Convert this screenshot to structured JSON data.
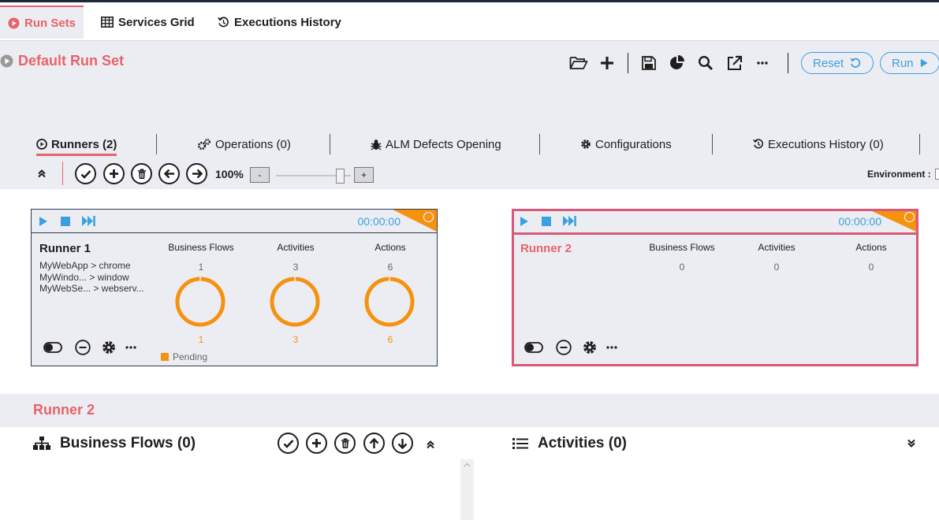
{
  "tabs": [
    {
      "label": "Run Sets",
      "icon": "play-circle-icon",
      "active": true
    },
    {
      "label": "Services Grid",
      "icon": "table-icon",
      "active": false
    },
    {
      "label": "Executions History",
      "icon": "history-icon",
      "active": false
    }
  ],
  "runset": {
    "title": "Default Run Set",
    "toolbar": [
      "folder-open-icon",
      "plus-icon",
      "save-icon",
      "pie-chart-icon",
      "search-icon",
      "external-link-icon",
      "more-icon"
    ],
    "reset_label": "Reset",
    "run_label": "Run"
  },
  "subtabs": [
    {
      "label": "Runners (2)",
      "icon": "play-circle-icon",
      "active": true
    },
    {
      "label": "Operations (0)",
      "icon": "gears-icon",
      "active": false
    },
    {
      "label": "ALM Defects Opening",
      "icon": "bug-icon",
      "active": false
    },
    {
      "label": "Configurations",
      "icon": "gear-icon",
      "active": false
    },
    {
      "label": "Executions History (0)",
      "icon": "history-icon",
      "active": false
    }
  ],
  "runner_toolbar": {
    "zoom": "100%",
    "zoom_minus": "-",
    "zoom_plus": "+",
    "zoom_level": 0.9,
    "environment_label": "Environment :"
  },
  "runners": [
    {
      "name": "Runner 1",
      "timer": "00:00:00",
      "apps": [
        "MyWebApp > chrome",
        "MyWindo... > window",
        "MyWebSe... > webserv..."
      ],
      "columns": [
        {
          "label": "Business Flows",
          "total": "1",
          "pending": "1"
        },
        {
          "label": "Activities",
          "total": "3",
          "pending": "3"
        },
        {
          "label": "Actions",
          "total": "6",
          "pending": "6"
        }
      ],
      "legend": "Pending"
    },
    {
      "name": "Runner 2",
      "timer": "00:00:00",
      "columns": [
        {
          "label": "Business Flows",
          "total": "0"
        },
        {
          "label": "Activities",
          "total": "0"
        },
        {
          "label": "Actions",
          "total": "0"
        }
      ]
    }
  ],
  "details": {
    "runner_title": "Runner 2",
    "business_flows_title": "Business Flows (0)",
    "activities_title": "Activities (0)"
  },
  "colors": {
    "accent": "#e8636b",
    "blue": "#3aa0e0",
    "orange": "#f5920f",
    "selected_border": "#d8587a"
  }
}
